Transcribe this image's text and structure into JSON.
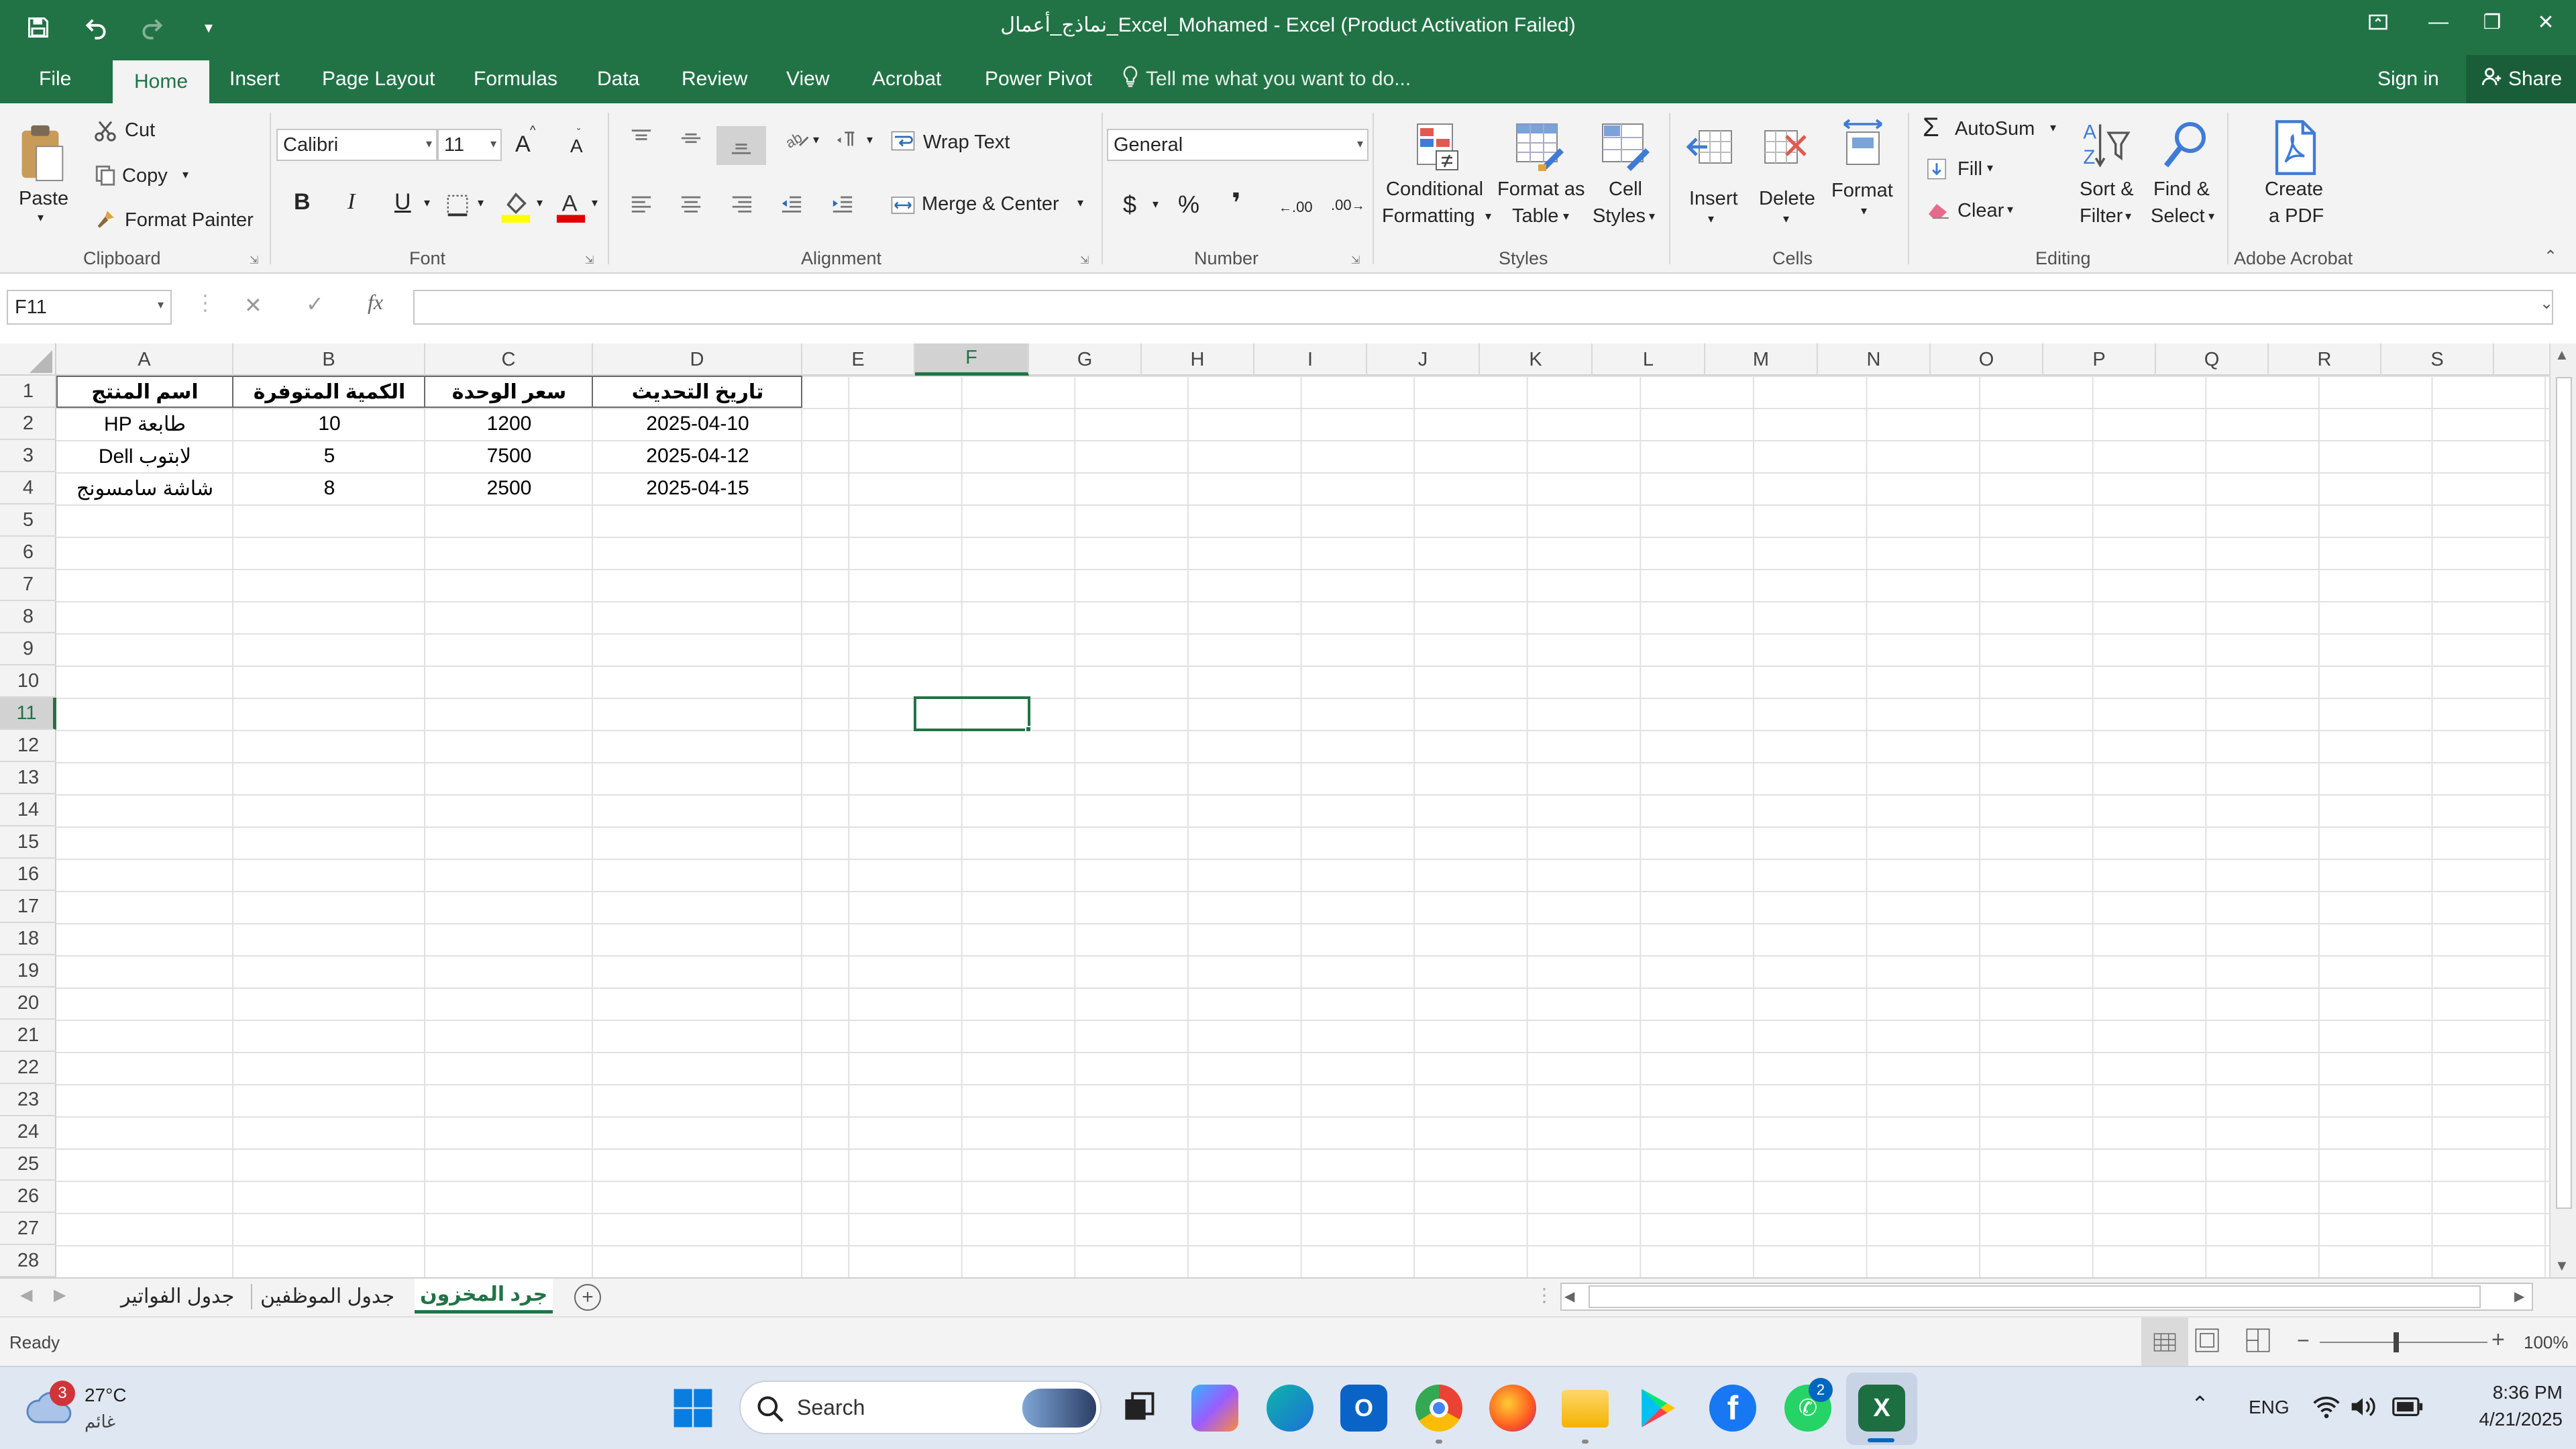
{
  "window": {
    "title": "نماذج_أعمال_Excel_Mohamed - Excel (Product Activation Failed)",
    "minimize_glyph": "—",
    "restore_glyph": "❐",
    "close_glyph": "✕"
  },
  "quick_access": {
    "save_icon": "save-icon",
    "undo_icon": "undo-icon",
    "redo_icon": "redo-icon",
    "customize_glyph": "▾"
  },
  "tabs": [
    {
      "label": "File"
    },
    {
      "label": "Home"
    },
    {
      "label": "Insert"
    },
    {
      "label": "Page Layout"
    },
    {
      "label": "Formulas"
    },
    {
      "label": "Data"
    },
    {
      "label": "Review"
    },
    {
      "label": "View"
    },
    {
      "label": "Acrobat"
    },
    {
      "label": "Power Pivot"
    }
  ],
  "tell_me": "Tell me what you want to do...",
  "sign_in": "Sign in",
  "share": "Share",
  "ribbon": {
    "clipboard": {
      "paste": "Paste",
      "cut": "Cut",
      "copy": "Copy",
      "format_painter": "Format Painter",
      "group": "Clipboard"
    },
    "font": {
      "name": "Calibri",
      "size": "11",
      "bold": "B",
      "italic": "I",
      "underline": "U",
      "grow": "A",
      "shrink": "A",
      "group": "Font"
    },
    "alignment": {
      "wrap_text": "Wrap Text",
      "merge_center": "Merge & Center",
      "group": "Alignment"
    },
    "number": {
      "format": "General",
      "currency": "$",
      "percent": "%",
      "comma": "❜",
      "inc_decimal": ".00",
      "dec_decimal": ".00",
      "group": "Number"
    },
    "styles": {
      "conditional_1": "Conditional",
      "conditional_2": "Formatting",
      "format_table_1": "Format as",
      "format_table_2": "Table",
      "cell_styles_1": "Cell",
      "cell_styles_2": "Styles",
      "group": "Styles"
    },
    "cells": {
      "insert": "Insert",
      "delete": "Delete",
      "format": "Format",
      "group": "Cells"
    },
    "editing": {
      "autosum": "AutoSum",
      "fill": "Fill",
      "clear": "Clear",
      "sort_1": "Sort &",
      "sort_2": "Filter",
      "find_1": "Find &",
      "find_2": "Select",
      "group": "Editing"
    },
    "acrobat": {
      "create_1": "Create",
      "create_2": "a PDF",
      "group": "Adobe Acrobat"
    }
  },
  "formula_bar": {
    "name_box": "F11",
    "cancel": "✕",
    "enter": "✓",
    "fx": "fx",
    "formula": ""
  },
  "columns": [
    "A",
    "B",
    "C",
    "D",
    "E",
    "F",
    "G",
    "H",
    "I",
    "J",
    "K",
    "L",
    "M",
    "N",
    "O",
    "P",
    "Q",
    "R",
    "S"
  ],
  "rows": [
    "1",
    "2",
    "3",
    "4",
    "5",
    "6",
    "7",
    "8",
    "9",
    "10",
    "11",
    "12",
    "13",
    "14",
    "15",
    "16",
    "17",
    "18",
    "19",
    "20",
    "21",
    "22",
    "23",
    "24",
    "25",
    "26",
    "27",
    "28"
  ],
  "selected_cell": {
    "column": "F",
    "row": "11"
  },
  "table": {
    "headers": [
      "اسم المنتج",
      "الكمية المتوفرة",
      "سعر الوحدة",
      "تاريخ التحديث"
    ],
    "rows": [
      [
        "طابعة HP",
        "10",
        "1200",
        "2025-04-10"
      ],
      [
        "لابتوب Dell",
        "5",
        "7500",
        "2025-04-12"
      ],
      [
        "شاشة سامسونج",
        "8",
        "2500",
        "2025-04-15"
      ]
    ]
  },
  "sheets": [
    {
      "name": "جدول الفواتير"
    },
    {
      "name": "جدول الموظفين"
    },
    {
      "name": "جرد المخزون"
    }
  ],
  "status": {
    "ready": "Ready",
    "zoom": "100%"
  },
  "taskbar": {
    "weather_temp": "27°C",
    "weather_desc": "غائم",
    "weather_badge": "3",
    "search": "Search",
    "whatsapp_badge": "2",
    "language": "ENG",
    "time": "8:36 PM",
    "date": "4/21/2025"
  },
  "colors": {
    "excel_green": "#217346",
    "selection": "#217346",
    "ribbon_bg": "#f3f3f3",
    "taskbar_bg": "#dfe7f2"
  }
}
